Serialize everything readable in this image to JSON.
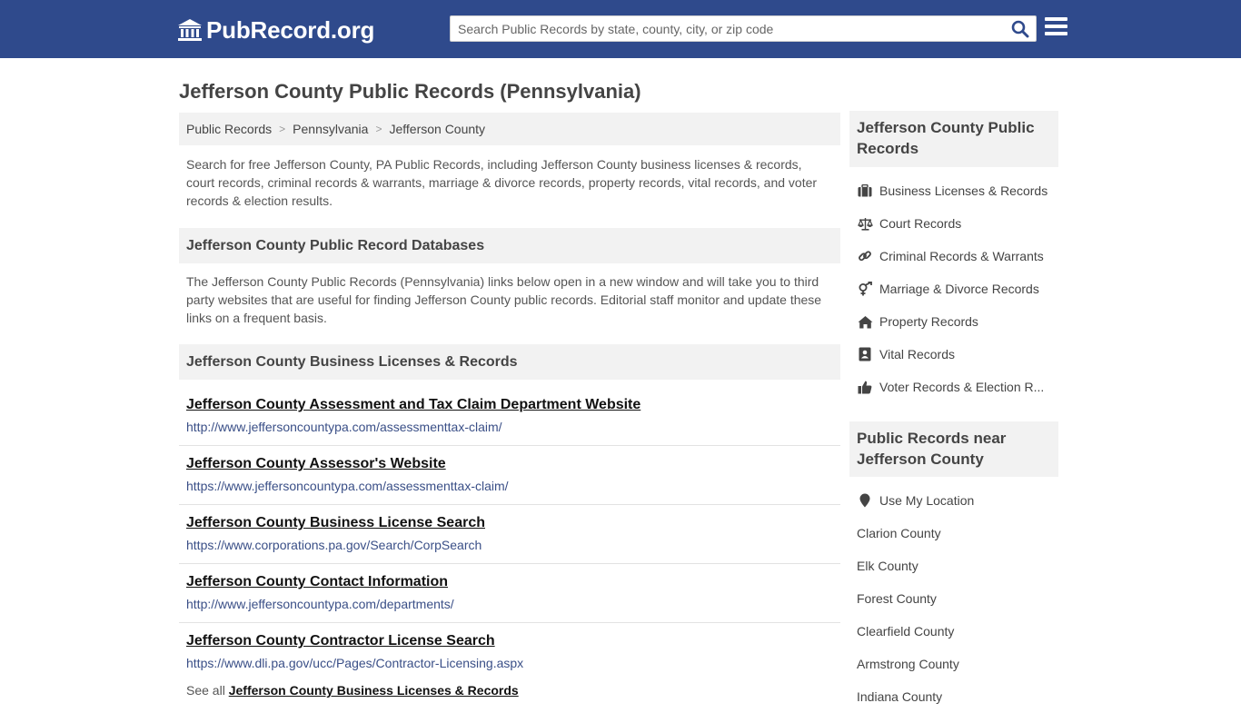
{
  "header": {
    "logo_text": "PubRecord.org",
    "search_placeholder": "Search Public Records by state, county, city, or zip code",
    "brand_color": "#2f4a8c"
  },
  "page": {
    "title": "Jefferson County Public Records (Pennsylvania)"
  },
  "breadcrumb": [
    "Public Records",
    "Pennsylvania",
    "Jefferson County"
  ],
  "intro": "Search for free Jefferson County, PA Public Records, including Jefferson County business licenses & records, court records, criminal records & warrants, marriage & divorce records, property records, vital records, and voter records & election results.",
  "databases": {
    "heading": "Jefferson County Public Record Databases",
    "description": "The Jefferson County Public Records (Pennsylvania) links below open in a new window and will take you to third party websites that are useful for finding Jefferson County public records. Editorial staff monitor and update these links on a frequent basis."
  },
  "business": {
    "heading": "Jefferson County Business Licenses & Records",
    "links": [
      {
        "title": "Jefferson County Assessment and Tax Claim Department Website",
        "url": "http://www.jeffersoncountypa.com/assessmenttax-claim/"
      },
      {
        "title": "Jefferson County Assessor's Website",
        "url": "https://www.jeffersoncountypa.com/assessmenttax-claim/"
      },
      {
        "title": "Jefferson County Business License Search",
        "url": "https://www.corporations.pa.gov/Search/CorpSearch"
      },
      {
        "title": "Jefferson County Contact Information",
        "url": "http://www.jeffersoncountypa.com/departments/"
      },
      {
        "title": "Jefferson County Contractor License Search",
        "url": "https://www.dli.pa.gov/ucc/Pages/Contractor-Licensing.aspx"
      }
    ],
    "see_all_prefix": "See all",
    "see_all_link": "Jefferson County Business Licenses & Records"
  },
  "sidebar": {
    "records_heading": "Jefferson County Public Records",
    "records": [
      {
        "label": "Business Licenses & Records",
        "icon": "briefcase-icon"
      },
      {
        "label": "Court Records",
        "icon": "scales-icon"
      },
      {
        "label": "Criminal Records & Warrants",
        "icon": "link-icon"
      },
      {
        "label": "Marriage & Divorce Records",
        "icon": "gender-icon"
      },
      {
        "label": "Property Records",
        "icon": "home-icon"
      },
      {
        "label": "Vital Records",
        "icon": "id-card-icon"
      },
      {
        "label": "Voter Records & Election R...",
        "icon": "thumbs-up-icon"
      }
    ],
    "nearby_heading": "Public Records near Jefferson County",
    "location_label": "Use My Location",
    "nearby": [
      "Clarion County",
      "Elk County",
      "Forest County",
      "Clearfield County",
      "Armstrong County",
      "Indiana County"
    ]
  }
}
